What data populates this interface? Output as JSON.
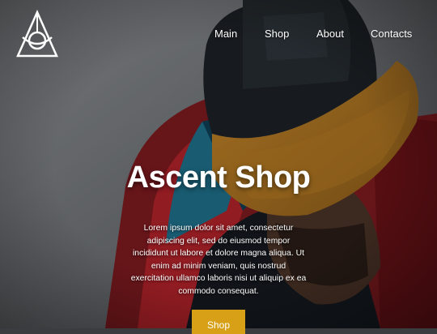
{
  "brand": {
    "logo_icon": "triangle-eye-icon"
  },
  "nav": {
    "items": [
      {
        "label": "Main"
      },
      {
        "label": "Shop"
      },
      {
        "label": "About"
      },
      {
        "label": "Contacts"
      }
    ]
  },
  "hero": {
    "title": "Ascent Shop",
    "description": "Lorem ipsum dolor sit amet, consectetur adipiscing elit, sed do eiusmod tempor incididunt ut labore et dolore magna aliqua. Ut enim ad minim veniam, quis nostrud exercitation ullamco laboris nisi ut aliquip ex ea commodo consequat.",
    "cta_label": "Shop",
    "cta_color": "#d7a017"
  }
}
